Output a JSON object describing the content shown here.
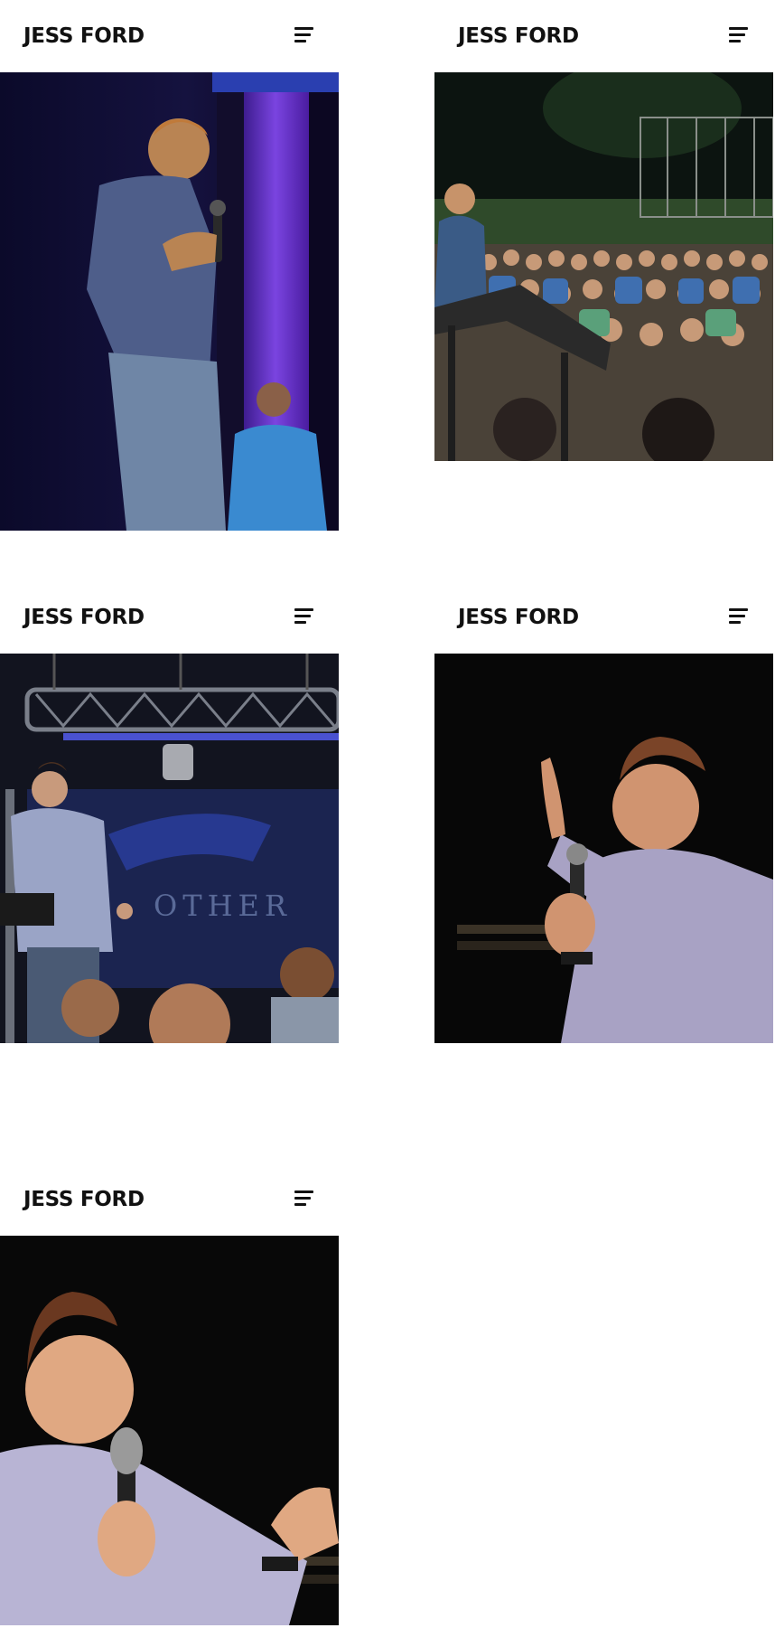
{
  "brand": "JESS FORD",
  "menu_icon": "hamburger-menu-icon",
  "backdrop_word": "OTHER",
  "panels": [
    {
      "photo": "speaker-on-stage-purple-light"
    },
    {
      "photo": "outdoor-crowd-at-night"
    },
    {
      "photo": "speaker-in-front-of-banner"
    },
    {
      "photo": "speaker-raising-hand-dark"
    },
    {
      "photo": "speaker-smiling-with-mic-dark"
    }
  ],
  "colors": {
    "background": "#ffffff",
    "text": "#111111",
    "stage_purple": "#6a2fd0",
    "stage_blue": "#2a3fb0"
  }
}
